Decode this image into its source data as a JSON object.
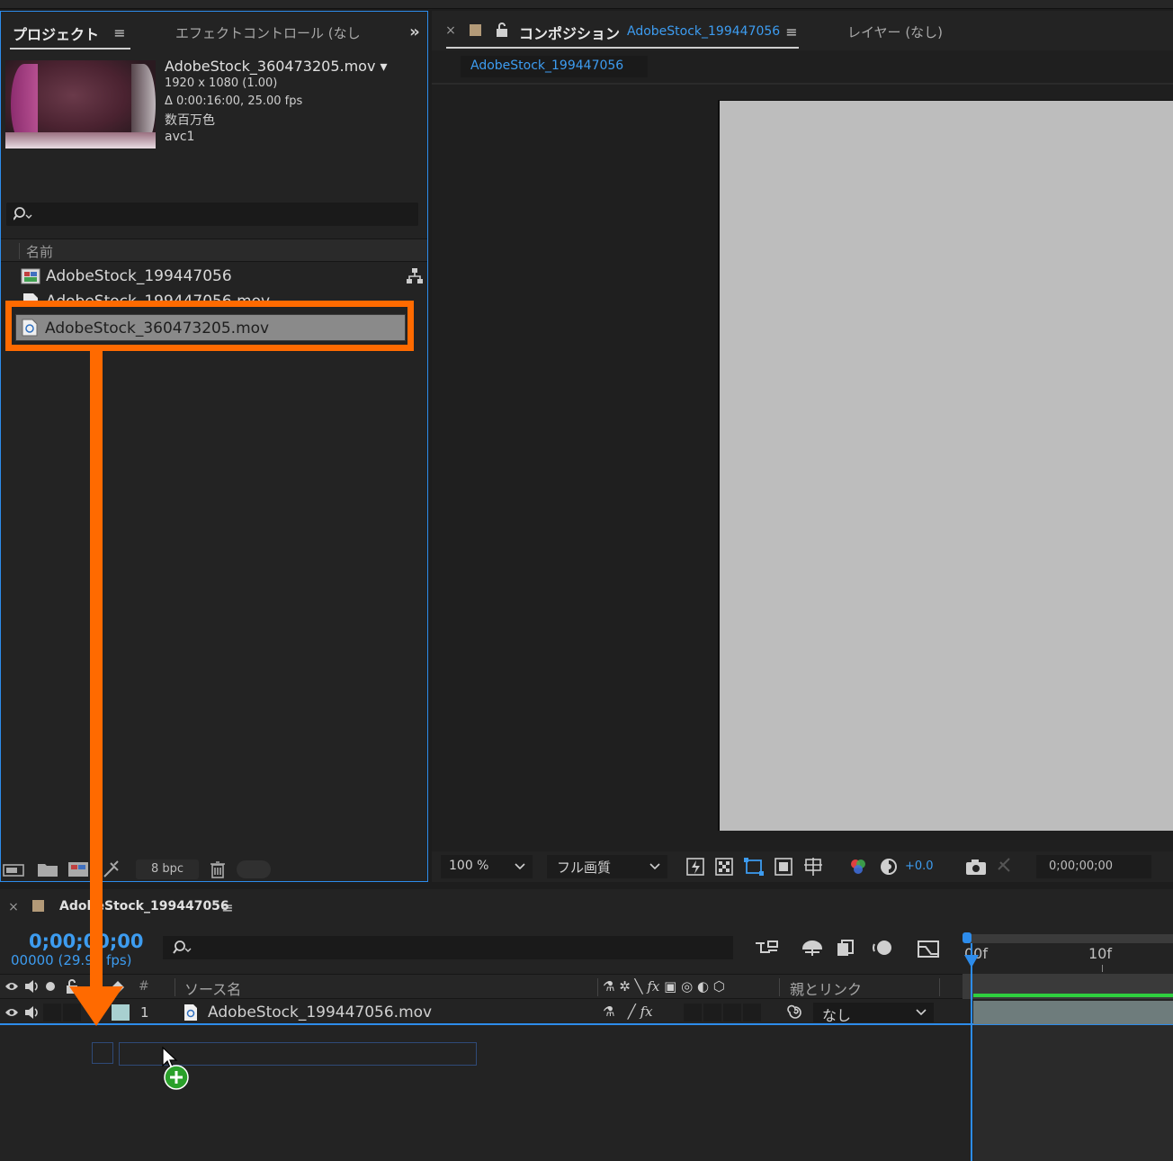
{
  "project_panel": {
    "tab_label": "プロジェクト",
    "effect_tab_label": "エフェクトコントロール (なし",
    "preview": {
      "filename": "AdobeStock_360473205.mov ▾",
      "resolution": "1920 x 1080 (1.00)",
      "duration": "Δ 0:00:16:00, 25.00 fps",
      "colors": "数百万色",
      "codec": "avc1"
    },
    "column_name": "名前",
    "items": [
      {
        "name": "AdobeStock_199447056",
        "type": "composition"
      },
      {
        "name": "AdobeStock_199447056.mov",
        "type": "footage"
      },
      {
        "name": "AdobeStock_360473205.mov",
        "type": "footage"
      }
    ],
    "bpc_label": "8 bpc"
  },
  "composition_panel": {
    "tab_label": "コンポジション",
    "comp_name": "AdobeStock_199447056",
    "layer_tab_label": "レイヤー (なし)",
    "subtab_label": "AdobeStock_199447056",
    "zoom": "100 %",
    "quality": "フル画質",
    "exposure": "+0.0",
    "timecode": "0;00;00;00"
  },
  "timeline_panel": {
    "comp_name": "AdobeStock_199447056",
    "timecode": "0;00;00;00",
    "fps_label": "00000 (29.97 fps)",
    "columns": {
      "number": "#",
      "source_name": "ソース名",
      "parent": "親とリンク"
    },
    "layers": [
      {
        "number": "1",
        "name": "AdobeStock_199447056.mov",
        "parent": "なし"
      }
    ],
    "ruler": {
      "mark0": "00f",
      "mark1": "10f"
    }
  },
  "annotation": {
    "color": "#ff6a00"
  },
  "colors": {
    "accent_blue": "#2d8ceb",
    "panel_bg": "#232323",
    "label_swatch": "#a8d0d0",
    "comp_canvas": "#bdbdbd",
    "orange": "#ff6a00"
  }
}
